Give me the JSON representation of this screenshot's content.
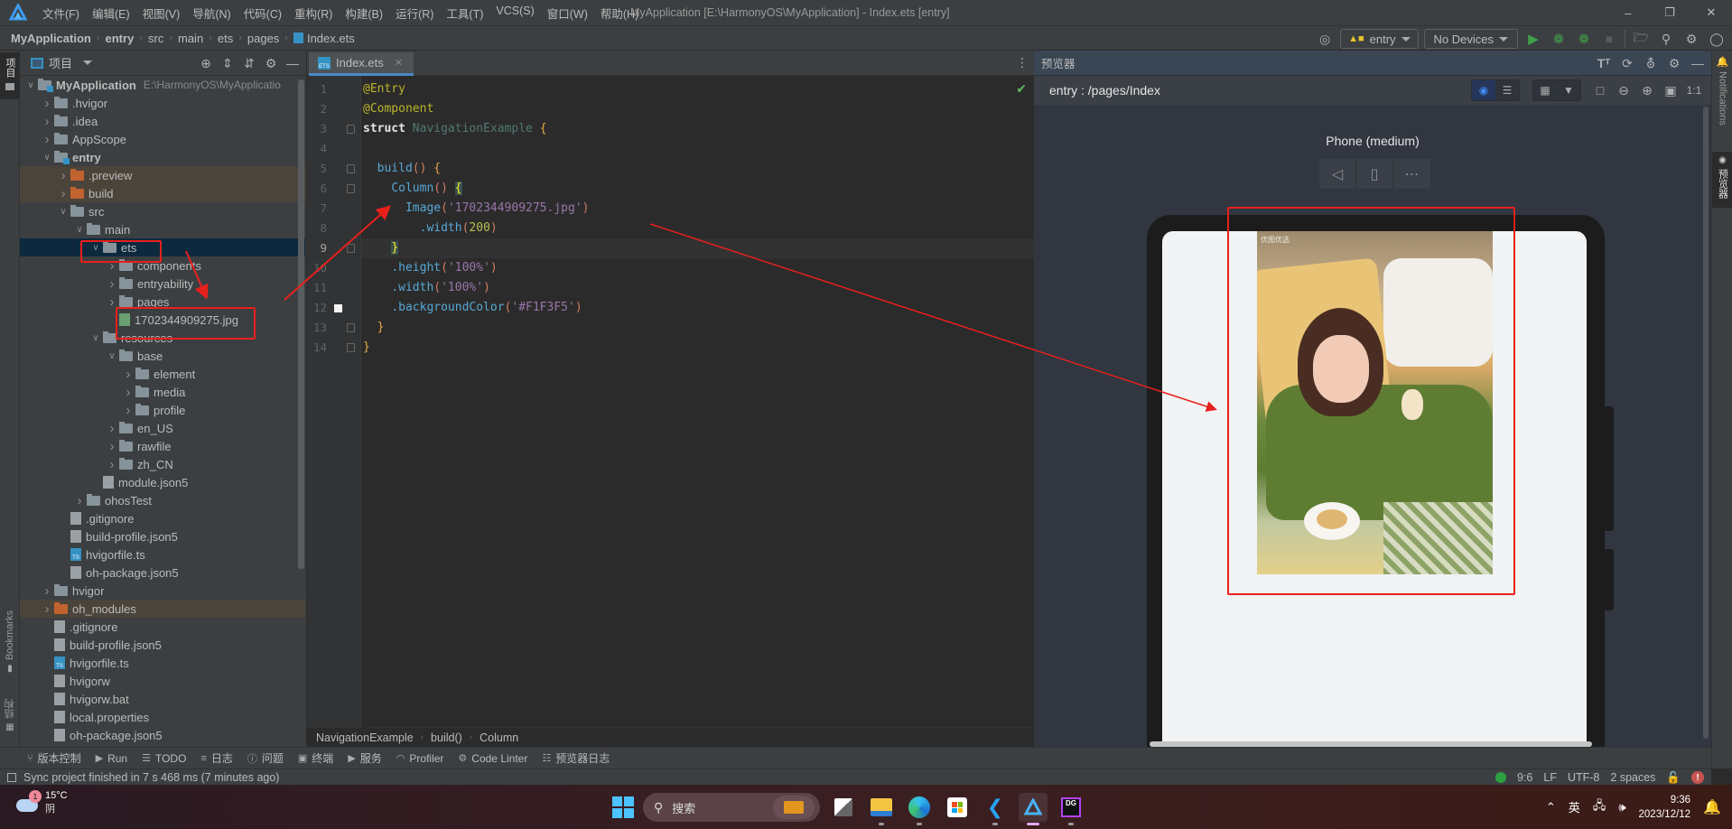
{
  "titlebar": {
    "menus": [
      "文件(F)",
      "编辑(E)",
      "视图(V)",
      "导航(N)",
      "代码(C)",
      "重构(R)",
      "构建(B)",
      "运行(R)",
      "工具(T)",
      "VCS(S)",
      "窗口(W)",
      "帮助(H)"
    ],
    "window_title": "MyApplication [E:\\HarmonyOS\\MyApplication] - Index.ets [entry]"
  },
  "navbar": {
    "breadcrumb": [
      "MyApplication",
      "entry",
      "src",
      "main",
      "ets",
      "pages",
      "Index.ets"
    ],
    "run_config": "entry",
    "device": "No Devices"
  },
  "project": {
    "title": "项目",
    "left_tab": "项目",
    "tree": [
      {
        "label": "MyApplication",
        "depth": 0,
        "arrow": "open",
        "type": "module",
        "bold": true,
        "path": "E:\\HarmonyOS\\MyApplicatio"
      },
      {
        "label": ".hvigor",
        "depth": 1,
        "arrow": "closed",
        "type": "folder"
      },
      {
        "label": ".idea",
        "depth": 1,
        "arrow": "closed",
        "type": "folder"
      },
      {
        "label": "AppScope",
        "depth": 1,
        "arrow": "closed",
        "type": "folder"
      },
      {
        "label": "entry",
        "depth": 1,
        "arrow": "open",
        "type": "module",
        "bold": true
      },
      {
        "label": ".preview",
        "depth": 2,
        "arrow": "closed",
        "type": "folder-orange",
        "excluded": true
      },
      {
        "label": "build",
        "depth": 2,
        "arrow": "closed",
        "type": "folder-orange",
        "excluded": true
      },
      {
        "label": "src",
        "depth": 2,
        "arrow": "open",
        "type": "folder"
      },
      {
        "label": "main",
        "depth": 3,
        "arrow": "open",
        "type": "folder"
      },
      {
        "label": "ets",
        "depth": 4,
        "arrow": "open",
        "type": "folder",
        "selected": true
      },
      {
        "label": "components",
        "depth": 5,
        "arrow": "closed",
        "type": "folder"
      },
      {
        "label": "entryability",
        "depth": 5,
        "arrow": "closed",
        "type": "folder"
      },
      {
        "label": "pages",
        "depth": 5,
        "arrow": "closed",
        "type": "folder"
      },
      {
        "label": "1702344909275.jpg",
        "depth": 5,
        "arrow": "none",
        "type": "image"
      },
      {
        "label": "resources",
        "depth": 4,
        "arrow": "open",
        "type": "folder"
      },
      {
        "label": "base",
        "depth": 5,
        "arrow": "open",
        "type": "folder"
      },
      {
        "label": "element",
        "depth": 6,
        "arrow": "closed",
        "type": "folder"
      },
      {
        "label": "media",
        "depth": 6,
        "arrow": "closed",
        "type": "folder"
      },
      {
        "label": "profile",
        "depth": 6,
        "arrow": "closed",
        "type": "folder"
      },
      {
        "label": "en_US",
        "depth": 5,
        "arrow": "closed",
        "type": "folder"
      },
      {
        "label": "rawfile",
        "depth": 5,
        "arrow": "closed",
        "type": "folder"
      },
      {
        "label": "zh_CN",
        "depth": 5,
        "arrow": "closed",
        "type": "folder"
      },
      {
        "label": "module.json5",
        "depth": 4,
        "arrow": "none",
        "type": "json"
      },
      {
        "label": "ohosTest",
        "depth": 3,
        "arrow": "closed",
        "type": "folder"
      },
      {
        "label": ".gitignore",
        "depth": 2,
        "arrow": "none",
        "type": "file"
      },
      {
        "label": "build-profile.json5",
        "depth": 2,
        "arrow": "none",
        "type": "json"
      },
      {
        "label": "hvigorfile.ts",
        "depth": 2,
        "arrow": "none",
        "type": "ts"
      },
      {
        "label": "oh-package.json5",
        "depth": 2,
        "arrow": "none",
        "type": "json"
      },
      {
        "label": "hvigor",
        "depth": 1,
        "arrow": "closed",
        "type": "folder"
      },
      {
        "label": "oh_modules",
        "depth": 1,
        "arrow": "closed",
        "type": "folder-orange",
        "excluded": true
      },
      {
        "label": ".gitignore",
        "depth": 1,
        "arrow": "none",
        "type": "file"
      },
      {
        "label": "build-profile.json5",
        "depth": 1,
        "arrow": "none",
        "type": "json"
      },
      {
        "label": "hvigorfile.ts",
        "depth": 1,
        "arrow": "none",
        "type": "ts"
      },
      {
        "label": "hvigorw",
        "depth": 1,
        "arrow": "none",
        "type": "file"
      },
      {
        "label": "hvigorw.bat",
        "depth": 1,
        "arrow": "none",
        "type": "file"
      },
      {
        "label": "local.properties",
        "depth": 1,
        "arrow": "none",
        "type": "file"
      },
      {
        "label": "oh-package.json5",
        "depth": 1,
        "arrow": "none",
        "type": "json"
      }
    ],
    "bookmarks_label": "Bookmarks",
    "structure_label": "结构"
  },
  "editor": {
    "tab": "Index.ets",
    "lines": [
      {
        "n": 1,
        "tokens": [
          [
            "ann",
            "@Entry"
          ]
        ]
      },
      {
        "n": 2,
        "tokens": [
          [
            "ann",
            "@Component"
          ]
        ]
      },
      {
        "n": 3,
        "tokens": [
          [
            "kws",
            "struct "
          ],
          [
            "ty",
            "NavigationExample "
          ],
          [
            "br",
            "{"
          ]
        ]
      },
      {
        "n": 4,
        "tokens": []
      },
      {
        "n": 5,
        "tokens": [
          [
            "wh",
            "  "
          ],
          [
            "fn",
            "build"
          ],
          [
            "pr",
            "() "
          ],
          [
            "br",
            "{"
          ]
        ]
      },
      {
        "n": 6,
        "tokens": [
          [
            "wh",
            "    "
          ],
          [
            "fn",
            "Column"
          ],
          [
            "pr",
            "() "
          ],
          [
            "yb",
            "{"
          ]
        ]
      },
      {
        "n": 7,
        "tokens": [
          [
            "wh",
            "      "
          ],
          [
            "fn",
            "Image"
          ],
          [
            "pr",
            "("
          ],
          [
            "st",
            "'1702344909275.jpg'"
          ],
          [
            "pr",
            ")"
          ]
        ]
      },
      {
        "n": 8,
        "tokens": [
          [
            "wh",
            "        "
          ],
          [
            "fn",
            ".width"
          ],
          [
            "pr",
            "("
          ],
          [
            "nm",
            "200"
          ],
          [
            "pr",
            ")"
          ]
        ]
      },
      {
        "n": 9,
        "tokens": [
          [
            "wh",
            "    "
          ],
          [
            "yb",
            "}"
          ]
        ]
      },
      {
        "n": 10,
        "tokens": [
          [
            "wh",
            "    "
          ],
          [
            "fn",
            ".height"
          ],
          [
            "pr",
            "("
          ],
          [
            "st",
            "'100%'"
          ],
          [
            "pr",
            ")"
          ]
        ]
      },
      {
        "n": 11,
        "tokens": [
          [
            "wh",
            "    "
          ],
          [
            "fn",
            ".width"
          ],
          [
            "pr",
            "("
          ],
          [
            "st",
            "'100%'"
          ],
          [
            "pr",
            ")"
          ]
        ]
      },
      {
        "n": 12,
        "tokens": [
          [
            "wh",
            "    "
          ],
          [
            "fn",
            ".backgroundColor"
          ],
          [
            "pr",
            "("
          ],
          [
            "st",
            "'#F1F3F5'"
          ],
          [
            "pr",
            ")"
          ]
        ]
      },
      {
        "n": 13,
        "tokens": [
          [
            "wh",
            "  "
          ],
          [
            "br",
            "}"
          ]
        ]
      },
      {
        "n": 14,
        "tokens": [
          [
            "br",
            "}"
          ]
        ]
      }
    ],
    "breadcrumb": [
      "NavigationExample",
      "build()",
      "Column"
    ]
  },
  "preview": {
    "title": "预览器",
    "route": "entry : /pages/Index",
    "device_name": "Phone (medium)",
    "zoom_label": "1:1",
    "screen_background": "#F1F3F5",
    "photo_watermark": "优图优选"
  },
  "right_strip": {
    "notifications": "Notifications",
    "previewer": "预览器"
  },
  "tool_tabs": [
    {
      "icon": "branch",
      "label": "版本控制"
    },
    {
      "icon": "play",
      "label": "Run"
    },
    {
      "icon": "list",
      "label": "TODO"
    },
    {
      "icon": "log",
      "label": "日志"
    },
    {
      "icon": "warning",
      "label": "问题"
    },
    {
      "icon": "terminal",
      "label": "终端"
    },
    {
      "icon": "service",
      "label": "服务"
    },
    {
      "icon": "gauge",
      "label": "Profiler"
    },
    {
      "icon": "linter",
      "label": "Code Linter"
    },
    {
      "icon": "doc",
      "label": "预览器日志"
    }
  ],
  "status": {
    "message": "Sync project finished in 7 s 468 ms (7 minutes ago)",
    "position": "9:6",
    "line_sep": "LF",
    "encoding": "UTF-8",
    "indent": "2 spaces"
  },
  "taskbar": {
    "weather_temp": "15°C",
    "weather_desc": "阴",
    "weather_badge": "1",
    "search_placeholder": "搜索",
    "ime": "英",
    "time": "9:36",
    "date": "2023/12/12"
  }
}
